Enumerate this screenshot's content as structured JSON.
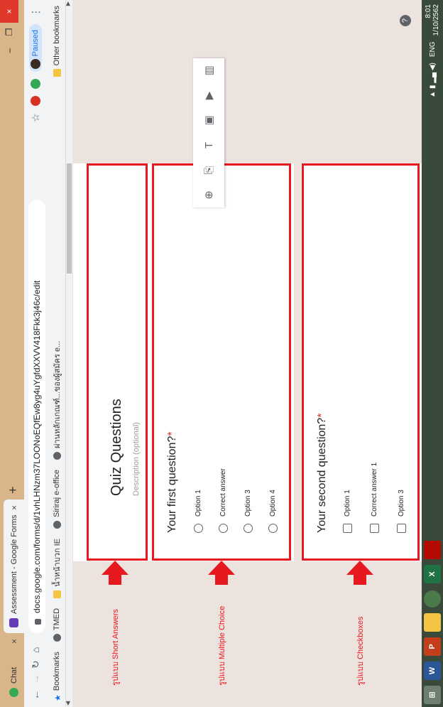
{
  "tabs": [
    {
      "title": "Chat",
      "close": "×"
    },
    {
      "title": "Assessment - Google Forms",
      "close": "×"
    }
  ],
  "new_tab": "+",
  "window_controls": {
    "minimize": "–",
    "maximize": "❐",
    "close": "×"
  },
  "omnibox": {
    "url": "docs.google.com/forms/d/1vhLHNzm37LOONoEQfEw8yg4uYgfdXXVV418Fkk3j46c/edit",
    "star_icon": "☆",
    "profile_label": "Paused",
    "menu_icon": "⋮"
  },
  "bookmarks": {
    "items": [
      "Bookmarks",
      "TMED",
      "น้ำหน้าบวก IE",
      "Siriraj e-office",
      "ผ่านหลักเกณฑ์...ของผู้สมัคร e..."
    ],
    "other": "Other bookmarks"
  },
  "form": {
    "title": "Quiz Questions",
    "description_placeholder": "Description (optional)",
    "q1": {
      "title": "Your first question?",
      "required": "*",
      "options": [
        "Option 1",
        "Correct answer",
        "Option 3",
        "Option 4"
      ]
    },
    "q2": {
      "title": "Your second question?",
      "required": "*",
      "options": [
        "Option 1",
        "Correct answer 1",
        "Option 3"
      ]
    }
  },
  "side_tools": [
    "add-question-icon",
    "import-icon",
    "title-icon",
    "image-icon",
    "video-icon",
    "section-icon"
  ],
  "annotations": [
    "รูปแบบ  Short Answers",
    "รูปแบบ  Multiple Choice",
    "รูปแบบ  Checkboxes"
  ],
  "help": "?",
  "taskbar": {
    "apps": [
      "W",
      "P",
      "",
      "",
      "X",
      ""
    ],
    "tray": {
      "lang": "ENG",
      "time": "8:01",
      "date": "1/10/2562"
    }
  },
  "colors": {
    "annotation_red": "#e5191f",
    "forms_purple": "#673ab7",
    "tab_bar": "#d9b58a",
    "page_bg": "#ece3df"
  }
}
